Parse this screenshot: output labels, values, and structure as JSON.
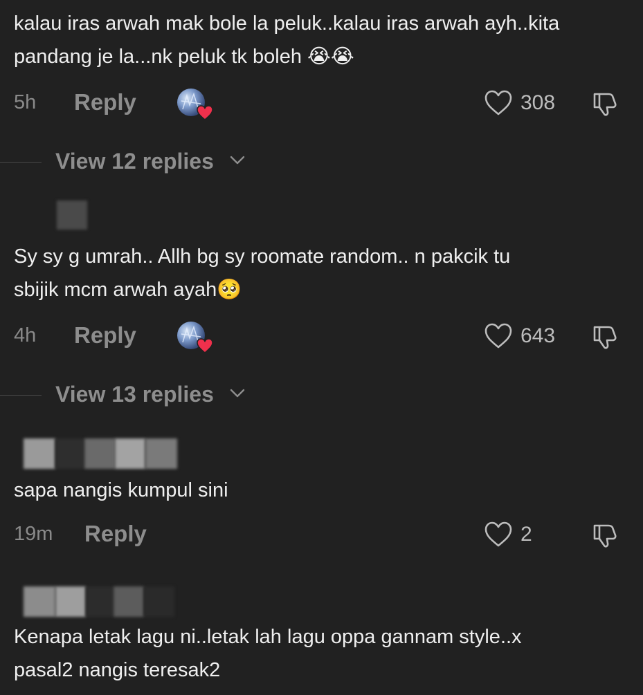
{
  "comments": [
    {
      "text_line1": "kalau iras arwah mak bole la peluk..kalau iras arwah ayh..kita",
      "text_line2": "pandang je la...nk peluk tk boleh 😭😭",
      "time": "5h",
      "reply_label": "Reply",
      "likes": "308",
      "creator_liked": true,
      "view_replies": "View 12 replies"
    },
    {
      "text_line1": "Sy sy g umrah.. Allh bg sy roomate random.. n pakcik tu",
      "text_line2": "sbijik mcm arwah ayah🥺",
      "time": "4h",
      "reply_label": "Reply",
      "likes": "643",
      "creator_liked": true,
      "view_replies": "View 13 replies"
    },
    {
      "text_line1": "sapa nangis kumpul sini",
      "time": "19m",
      "reply_label": "Reply",
      "likes": "2",
      "creator_liked": false
    },
    {
      "text_line1": "Kenapa letak lagu ni..letak lah lagu oppa gannam style..x",
      "text_line2": "pasal2 nangis teresak2"
    }
  ],
  "icons": {
    "like": "heart-outline-icon",
    "dislike": "thumbs-down-icon",
    "creator_like": "creator-heart-avatar-icon",
    "expand": "chevron-down-icon"
  },
  "colors": {
    "background": "#212121",
    "text": "#efefef",
    "muted": "#8d8d8d",
    "heart_badge": "#f0304c"
  }
}
